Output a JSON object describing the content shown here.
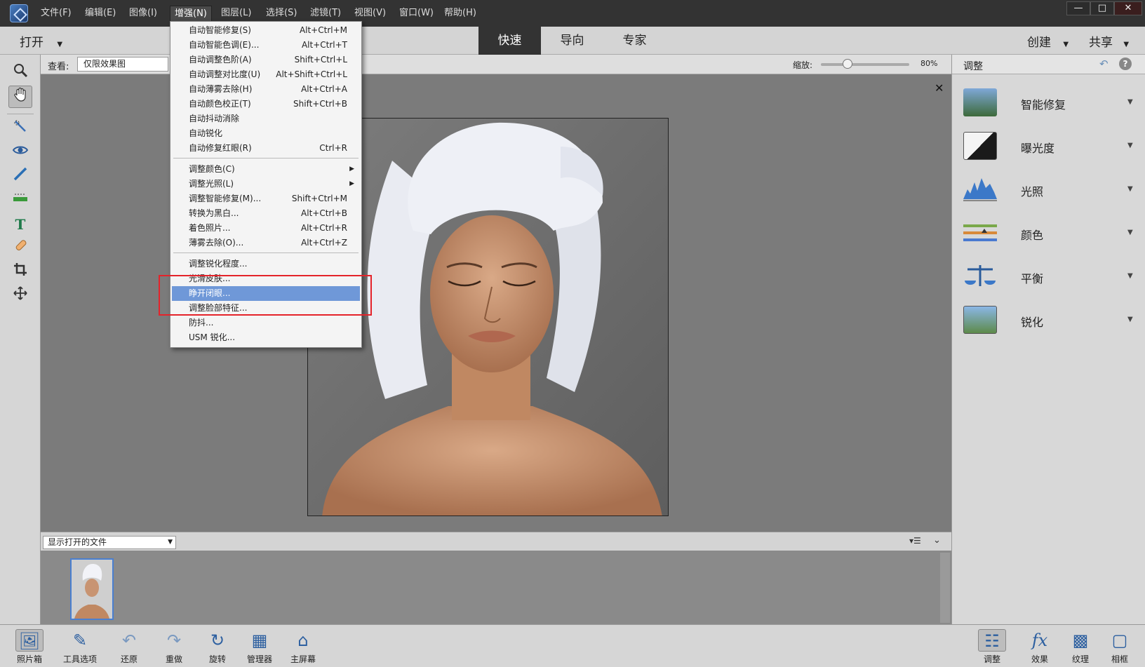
{
  "menubar": {
    "items": [
      "文件(F)",
      "编辑(E)",
      "图像(I)",
      "增强(N)",
      "图层(L)",
      "选择(S)",
      "滤镜(T)",
      "视图(V)",
      "窗口(W)",
      "帮助(H)"
    ],
    "window_controls": [
      "—",
      "□",
      "✕"
    ]
  },
  "modebar": {
    "open_label": "打开",
    "tabs": [
      "快速",
      "导向",
      "专家"
    ],
    "active_tab": "快速",
    "create_label": "创建",
    "share_label": "共享"
  },
  "options": {
    "view_label": "查看:",
    "view_value": "仅限效果图",
    "zoom_label": "缩放:",
    "zoom_value": "80%",
    "zoom_fraction": 0.3
  },
  "enhance_menu": {
    "items": [
      {
        "label": "自动智能修复(S)",
        "shortcut": "Alt+Ctrl+M"
      },
      {
        "label": "自动智能色调(E)...",
        "shortcut": "Alt+Ctrl+T"
      },
      {
        "label": "自动调整色阶(A)",
        "shortcut": "Shift+Ctrl+L"
      },
      {
        "label": "自动调整对比度(U)",
        "shortcut": "Alt+Shift+Ctrl+L"
      },
      {
        "label": "自动薄雾去除(H)",
        "shortcut": "Alt+Ctrl+A"
      },
      {
        "label": "自动颜色校正(T)",
        "shortcut": "Shift+Ctrl+B"
      },
      {
        "label": "自动抖动消除",
        "shortcut": ""
      },
      {
        "label": "自动锐化",
        "shortcut": ""
      },
      {
        "label": "自动修复红眼(R)",
        "shortcut": "Ctrl+R"
      },
      {
        "label": "调整颜色(C)",
        "shortcut": ""
      },
      {
        "label": "调整光照(L)",
        "shortcut": ""
      },
      {
        "label": "调整智能修复(M)...",
        "shortcut": "Shift+Ctrl+M"
      },
      {
        "label": "转换为黑白...",
        "shortcut": "Alt+Ctrl+B"
      },
      {
        "label": "着色照片...",
        "shortcut": "Alt+Ctrl+R"
      },
      {
        "label": "薄雾去除(O)...",
        "shortcut": "Alt+Ctrl+Z"
      },
      {
        "label": "调整锐化程度...",
        "shortcut": ""
      },
      {
        "label": "光滑皮肤...",
        "shortcut": ""
      },
      {
        "label": "睁开闭眼...",
        "shortcut": ""
      },
      {
        "label": "调整脸部特征...",
        "shortcut": ""
      },
      {
        "label": "防抖...",
        "shortcut": ""
      },
      {
        "label": "USM 锐化...",
        "shortcut": ""
      }
    ],
    "highlighted": "睁开闭眼..."
  },
  "bin": {
    "select_value": "显示打开的文件"
  },
  "panel": {
    "title": "调整",
    "items": [
      "智能修复",
      "曝光度",
      "光照",
      "颜色",
      "平衡",
      "锐化"
    ]
  },
  "bottombar": {
    "left": [
      "照片箱",
      "工具选项",
      "还原",
      "重做",
      "旋转",
      "管理器",
      "主屏幕"
    ],
    "right": [
      "调整",
      "效果",
      "纹理",
      "相框"
    ]
  },
  "colors": {
    "highlight": "#6f98d8",
    "annotation_box": "#e4232a",
    "active_tab_bg": "#333333"
  }
}
